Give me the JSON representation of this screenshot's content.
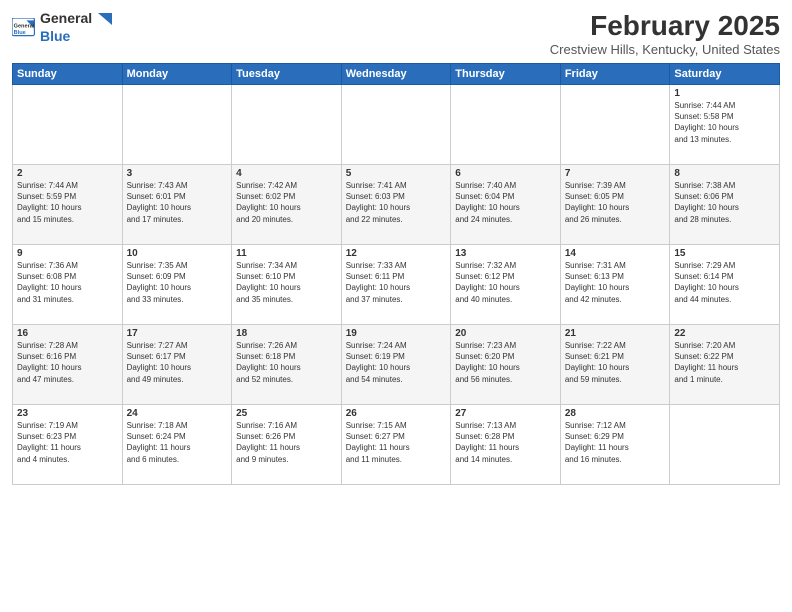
{
  "logo": {
    "general": "General",
    "blue": "Blue"
  },
  "title": "February 2025",
  "subtitle": "Crestview Hills, Kentucky, United States",
  "days_of_week": [
    "Sunday",
    "Monday",
    "Tuesday",
    "Wednesday",
    "Thursday",
    "Friday",
    "Saturday"
  ],
  "weeks": [
    [
      {
        "day": "",
        "info": ""
      },
      {
        "day": "",
        "info": ""
      },
      {
        "day": "",
        "info": ""
      },
      {
        "day": "",
        "info": ""
      },
      {
        "day": "",
        "info": ""
      },
      {
        "day": "",
        "info": ""
      },
      {
        "day": "1",
        "info": "Sunrise: 7:44 AM\nSunset: 5:58 PM\nDaylight: 10 hours\nand 13 minutes."
      }
    ],
    [
      {
        "day": "2",
        "info": "Sunrise: 7:44 AM\nSunset: 5:59 PM\nDaylight: 10 hours\nand 15 minutes."
      },
      {
        "day": "3",
        "info": "Sunrise: 7:43 AM\nSunset: 6:01 PM\nDaylight: 10 hours\nand 17 minutes."
      },
      {
        "day": "4",
        "info": "Sunrise: 7:42 AM\nSunset: 6:02 PM\nDaylight: 10 hours\nand 20 minutes."
      },
      {
        "day": "5",
        "info": "Sunrise: 7:41 AM\nSunset: 6:03 PM\nDaylight: 10 hours\nand 22 minutes."
      },
      {
        "day": "6",
        "info": "Sunrise: 7:40 AM\nSunset: 6:04 PM\nDaylight: 10 hours\nand 24 minutes."
      },
      {
        "day": "7",
        "info": "Sunrise: 7:39 AM\nSunset: 6:05 PM\nDaylight: 10 hours\nand 26 minutes."
      },
      {
        "day": "8",
        "info": "Sunrise: 7:38 AM\nSunset: 6:06 PM\nDaylight: 10 hours\nand 28 minutes."
      }
    ],
    [
      {
        "day": "9",
        "info": "Sunrise: 7:36 AM\nSunset: 6:08 PM\nDaylight: 10 hours\nand 31 minutes."
      },
      {
        "day": "10",
        "info": "Sunrise: 7:35 AM\nSunset: 6:09 PM\nDaylight: 10 hours\nand 33 minutes."
      },
      {
        "day": "11",
        "info": "Sunrise: 7:34 AM\nSunset: 6:10 PM\nDaylight: 10 hours\nand 35 minutes."
      },
      {
        "day": "12",
        "info": "Sunrise: 7:33 AM\nSunset: 6:11 PM\nDaylight: 10 hours\nand 37 minutes."
      },
      {
        "day": "13",
        "info": "Sunrise: 7:32 AM\nSunset: 6:12 PM\nDaylight: 10 hours\nand 40 minutes."
      },
      {
        "day": "14",
        "info": "Sunrise: 7:31 AM\nSunset: 6:13 PM\nDaylight: 10 hours\nand 42 minutes."
      },
      {
        "day": "15",
        "info": "Sunrise: 7:29 AM\nSunset: 6:14 PM\nDaylight: 10 hours\nand 44 minutes."
      }
    ],
    [
      {
        "day": "16",
        "info": "Sunrise: 7:28 AM\nSunset: 6:16 PM\nDaylight: 10 hours\nand 47 minutes."
      },
      {
        "day": "17",
        "info": "Sunrise: 7:27 AM\nSunset: 6:17 PM\nDaylight: 10 hours\nand 49 minutes."
      },
      {
        "day": "18",
        "info": "Sunrise: 7:26 AM\nSunset: 6:18 PM\nDaylight: 10 hours\nand 52 minutes."
      },
      {
        "day": "19",
        "info": "Sunrise: 7:24 AM\nSunset: 6:19 PM\nDaylight: 10 hours\nand 54 minutes."
      },
      {
        "day": "20",
        "info": "Sunrise: 7:23 AM\nSunset: 6:20 PM\nDaylight: 10 hours\nand 56 minutes."
      },
      {
        "day": "21",
        "info": "Sunrise: 7:22 AM\nSunset: 6:21 PM\nDaylight: 10 hours\nand 59 minutes."
      },
      {
        "day": "22",
        "info": "Sunrise: 7:20 AM\nSunset: 6:22 PM\nDaylight: 11 hours\nand 1 minute."
      }
    ],
    [
      {
        "day": "23",
        "info": "Sunrise: 7:19 AM\nSunset: 6:23 PM\nDaylight: 11 hours\nand 4 minutes."
      },
      {
        "day": "24",
        "info": "Sunrise: 7:18 AM\nSunset: 6:24 PM\nDaylight: 11 hours\nand 6 minutes."
      },
      {
        "day": "25",
        "info": "Sunrise: 7:16 AM\nSunset: 6:26 PM\nDaylight: 11 hours\nand 9 minutes."
      },
      {
        "day": "26",
        "info": "Sunrise: 7:15 AM\nSunset: 6:27 PM\nDaylight: 11 hours\nand 11 minutes."
      },
      {
        "day": "27",
        "info": "Sunrise: 7:13 AM\nSunset: 6:28 PM\nDaylight: 11 hours\nand 14 minutes."
      },
      {
        "day": "28",
        "info": "Sunrise: 7:12 AM\nSunset: 6:29 PM\nDaylight: 11 hours\nand 16 minutes."
      },
      {
        "day": "",
        "info": ""
      }
    ]
  ]
}
